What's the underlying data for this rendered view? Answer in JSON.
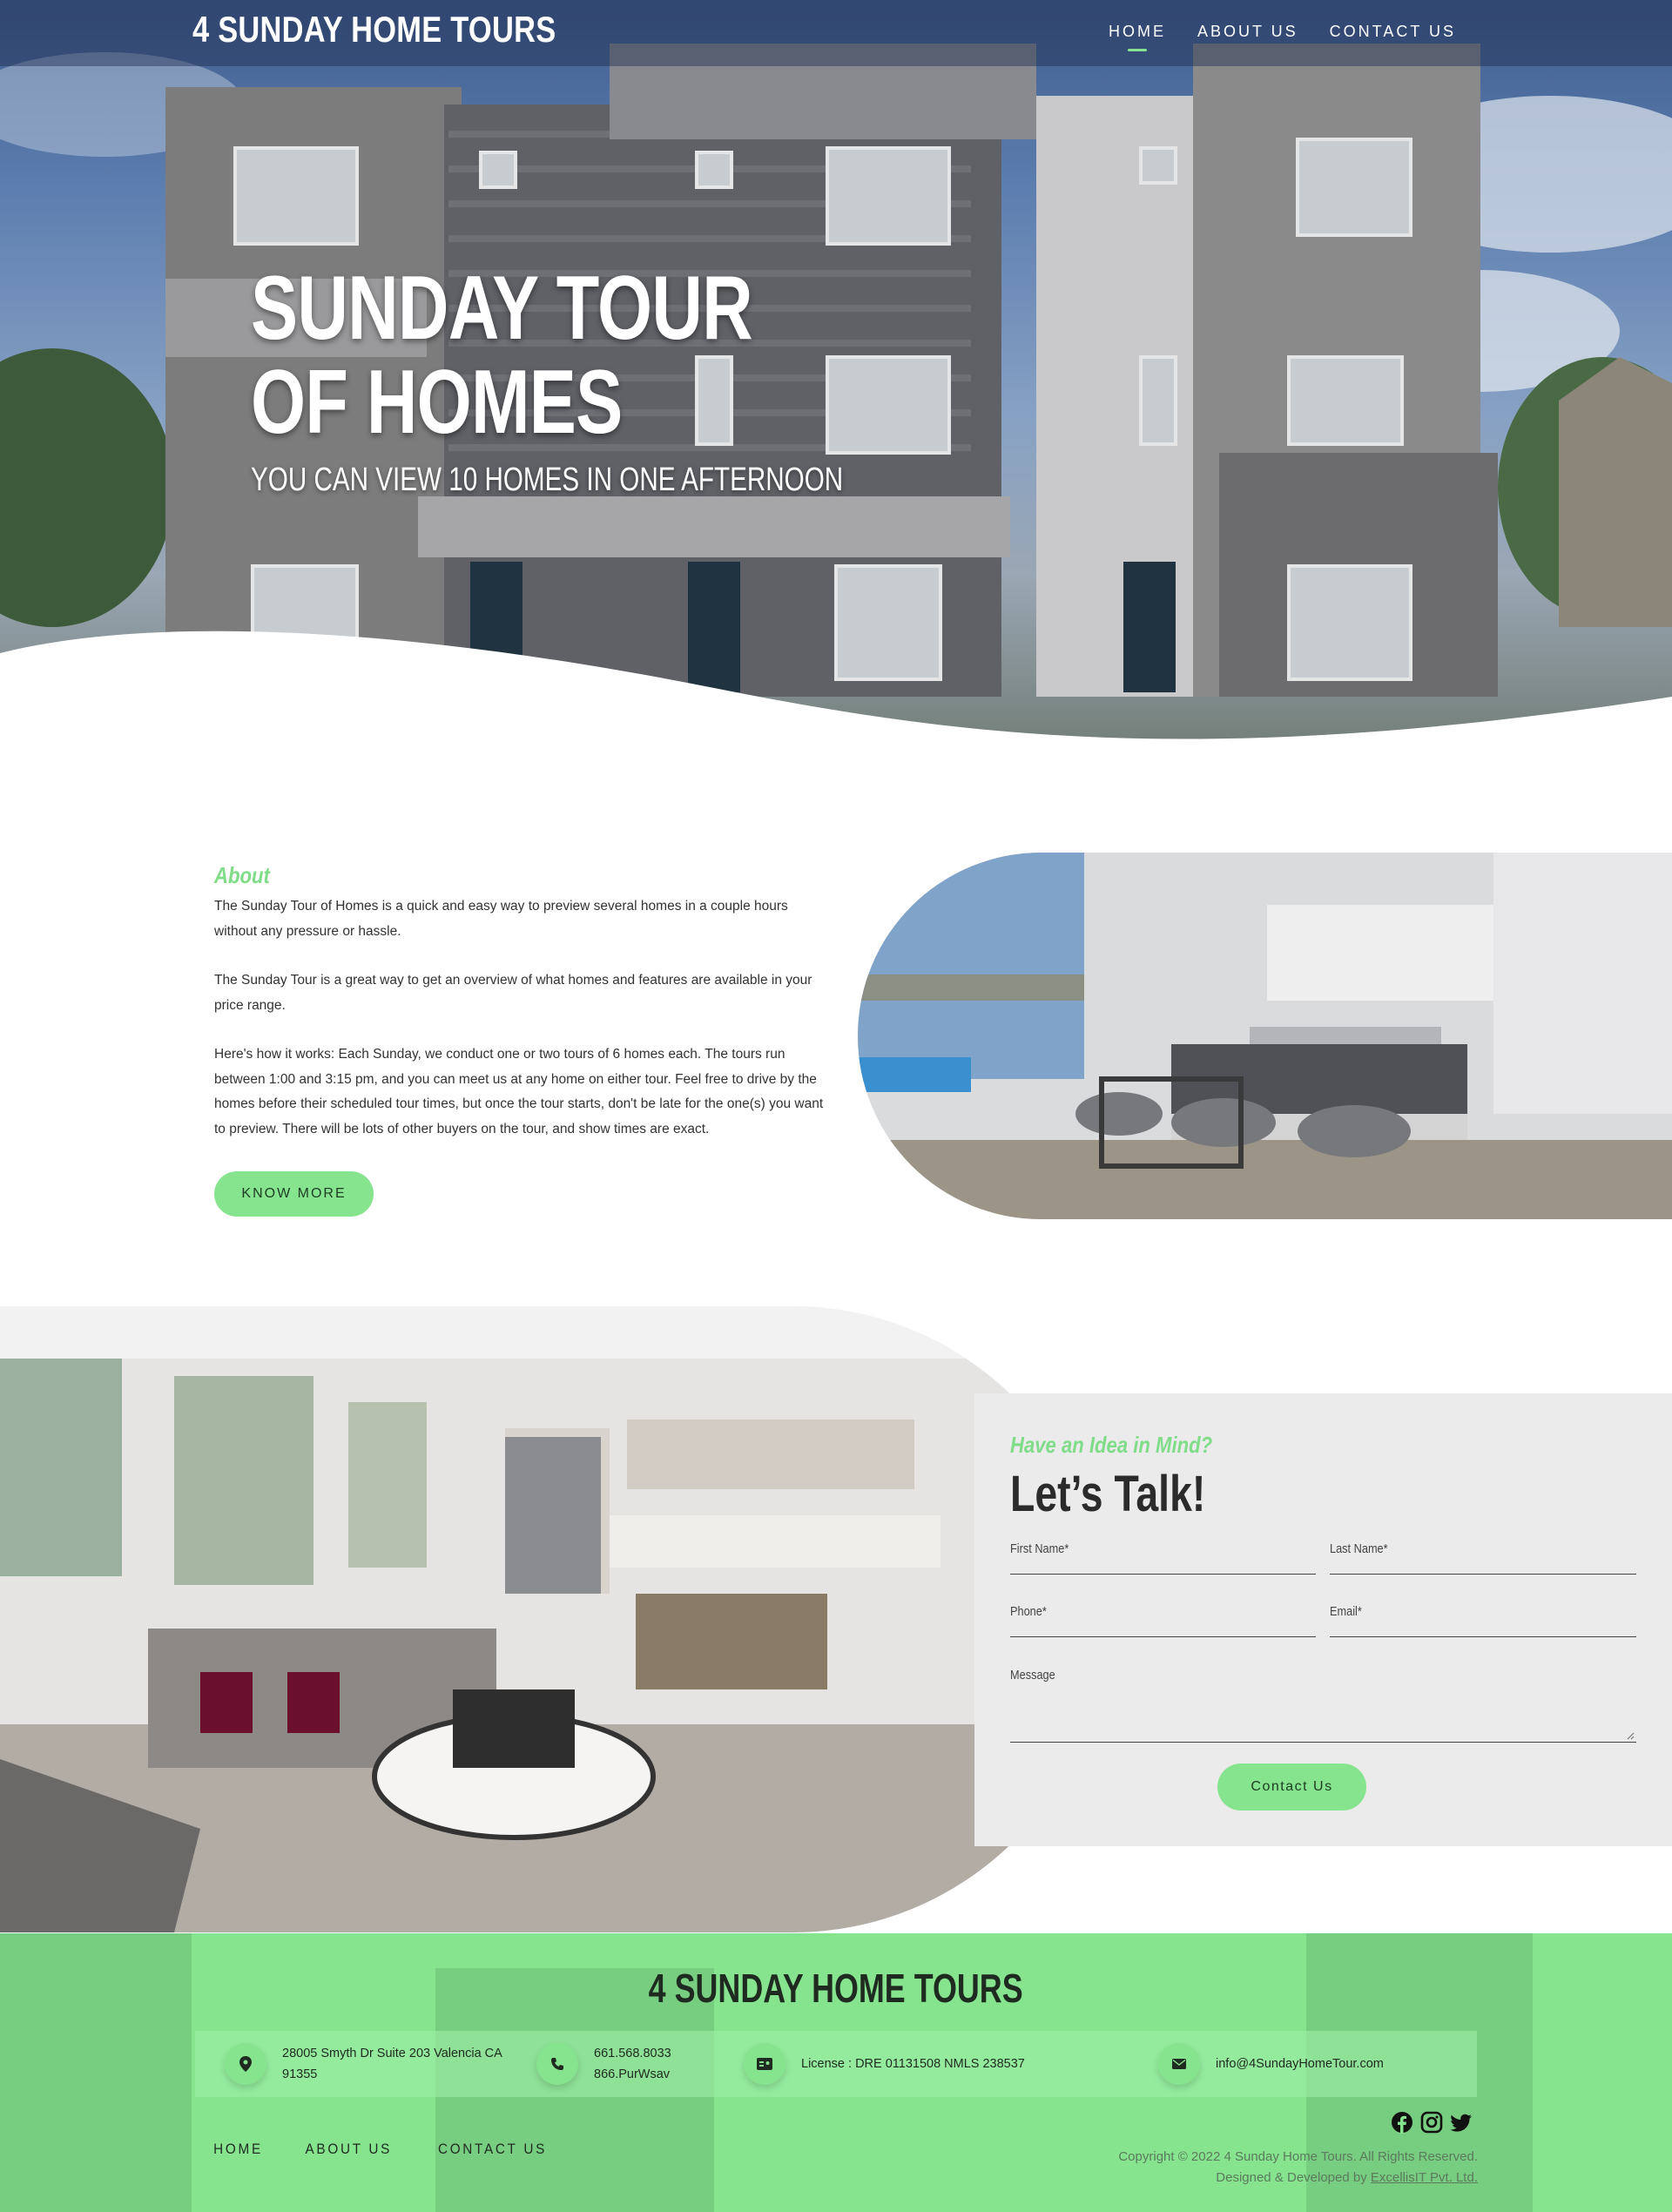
{
  "header": {
    "brand": "4 SUNDAY HOME TOURS",
    "nav": [
      {
        "label": "HOME",
        "active": true
      },
      {
        "label": "ABOUT US",
        "active": false
      },
      {
        "label": "CONTACT US",
        "active": false
      }
    ]
  },
  "hero": {
    "title_line1": "SUNDAY TOUR",
    "title_line2": "OF HOMES",
    "subtitle": "YOU CAN VIEW 10 HOMES IN ONE AFTERNOON"
  },
  "about": {
    "label": "About",
    "paragraphs": [
      "The Sunday Tour of Homes is a quick and easy way to preview several homes in a couple hours without any pressure or hassle.",
      "The Sunday Tour is a great way to get an overview of what homes and features are available in your price range.",
      "Here's how it works: Each Sunday, we conduct one or two tours of 6 homes each. The tours run between 1:00 and 3:15 pm, and you can meet us at any home on either tour. Feel free to drive by the homes before their scheduled tour times, but once the tour starts, don't be late for the one(s) you want to preview. There will be lots of other buyers on the tour, and show times are exact."
    ],
    "button": "KNOW MORE"
  },
  "contact": {
    "kicker": "Have an Idea in Mind?",
    "title": "Let’s Talk!",
    "fields": {
      "first_name": "First Name*",
      "last_name": "Last Name*",
      "phone": "Phone*",
      "email": "Email*",
      "message": "Message"
    },
    "button": "Contact Us"
  },
  "footer": {
    "brand": "4 SUNDAY HOME TOURS",
    "address_line1": "28005 Smyth Dr Suite 203 Valencia CA",
    "address_line2": "91355",
    "phone_line1": "661.568.8033",
    "phone_line2": "866.PurWsav",
    "license": "License : DRE 01131508 NMLS 238537",
    "email": "info@4SundayHomeTour.com",
    "nav": [
      "HOME",
      "ABOUT US",
      "CONTACT US"
    ],
    "copyright": "Copyright © 2022 4 Sunday Home Tours. All Rights Reserved.",
    "credit_prefix": "Designed & Developed by ",
    "credit_link": "ExcellisIT Pvt. Ltd."
  },
  "icons": {
    "location": "map-pin-icon",
    "phone": "phone-icon",
    "license": "id-card-icon",
    "email": "envelope-icon",
    "socials": [
      "facebook-icon",
      "instagram-icon",
      "twitter-icon"
    ]
  },
  "colors": {
    "accent": "#86e48f",
    "accent_text": "#7fdc88",
    "dark": "#1f2a20",
    "panel": "#ebebeb"
  }
}
